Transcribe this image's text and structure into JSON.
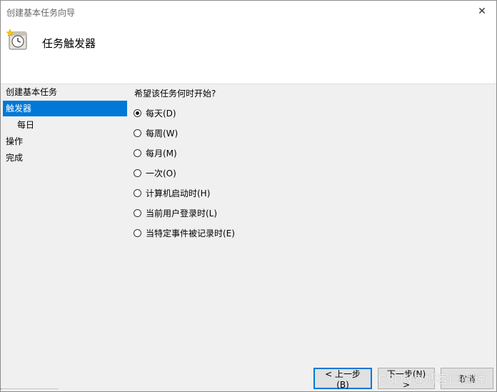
{
  "window": {
    "title": "创建基本任务向导",
    "close_glyph": "✕"
  },
  "header": {
    "title": "任务触发器",
    "icon": "clock-task-icon"
  },
  "sidebar": {
    "items": [
      {
        "label": "创建基本任务",
        "selected": false,
        "sub": false
      },
      {
        "label": "触发器",
        "selected": true,
        "sub": false
      },
      {
        "label": "每日",
        "selected": false,
        "sub": true
      },
      {
        "label": "操作",
        "selected": false,
        "sub": false
      },
      {
        "label": "完成",
        "selected": false,
        "sub": false
      }
    ]
  },
  "main": {
    "question": "希望该任务何时开始?",
    "options": [
      {
        "label": "每天(D)",
        "checked": true
      },
      {
        "label": "每周(W)",
        "checked": false
      },
      {
        "label": "每月(M)",
        "checked": false
      },
      {
        "label": "一次(O)",
        "checked": false
      },
      {
        "label": "计算机启动时(H)",
        "checked": false
      },
      {
        "label": "当前用户登录时(L)",
        "checked": false
      },
      {
        "label": "当特定事件被记录时(E)",
        "checked": false
      }
    ]
  },
  "buttons": {
    "back": "< 上一步(B)",
    "next": "下一步(N) >",
    "cancel": "取消"
  },
  "watermark": "CSDN@博客园@辉",
  "colors": {
    "accent": "#0078d7",
    "background": "#f0f0f0"
  }
}
